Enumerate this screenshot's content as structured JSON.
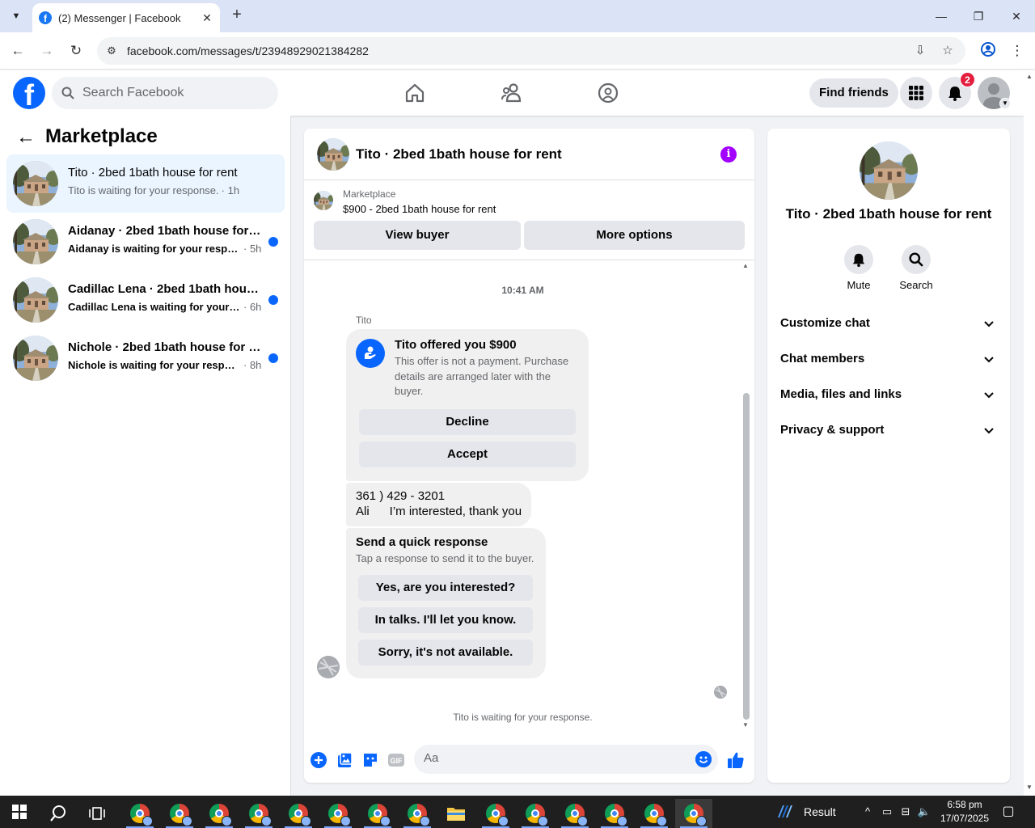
{
  "browser": {
    "tab_title": "(2) Messenger | Facebook",
    "url": "facebook.com/messages/t/23948929021384282"
  },
  "fb_header": {
    "search_placeholder": "Search Facebook",
    "find_friends": "Find friends",
    "notification_count": "2"
  },
  "sidebar": {
    "title": "Marketplace",
    "conversations": [
      {
        "name": "Tito · 2bed 1bath house for rent",
        "preview": "Tito is waiting for your response.",
        "time": "· 1h",
        "unread": false,
        "active": true
      },
      {
        "name": "Aidanay · 2bed 1bath house for r...",
        "preview": "Aidanay is waiting for your respon...",
        "time": "· 5h",
        "unread": true,
        "active": false
      },
      {
        "name": "Cadillac Lena · 2bed 1bath house...",
        "preview": "Cadillac Lena is waiting for your re...",
        "time": "· 6h",
        "unread": true,
        "active": false
      },
      {
        "name": "Nichole · 2bed 1bath house for r...",
        "preview": "Nichole is waiting for your respon...",
        "time": "· 8h",
        "unread": true,
        "active": false
      }
    ]
  },
  "chat": {
    "title": "Tito · 2bed 1bath house for rent",
    "listing_label": "Marketplace",
    "listing_price": "$900 - 2bed 1bath house for rent",
    "view_buyer": "View buyer",
    "more_options": "More options",
    "timestamp": "10:41 AM",
    "sender": "Tito",
    "offer": {
      "title": "Tito offered you $900",
      "description": "This offer is not a payment. Purchase details are arranged later with the buyer.",
      "decline": "Decline",
      "accept": "Accept"
    },
    "message": {
      "line1": "361 ) 429 - 3201",
      "line2": "Ali      I’m interested, thank you"
    },
    "quick_response": {
      "title": "Send a quick response",
      "subtitle": "Tap a response to send it to the buyer.",
      "options": [
        "Yes, are you interested?",
        "In talks. I'll let you know.",
        "Sorry, it's not available."
      ]
    },
    "waiting": "Tito is waiting for your response.",
    "composer_placeholder": "Aa",
    "gif_label": "GIF"
  },
  "right_panel": {
    "title": "Tito · 2bed 1bath house for rent",
    "actions": {
      "mute": "Mute",
      "search": "Search"
    },
    "sections": [
      "Customize chat",
      "Chat members",
      "Media, files and links",
      "Privacy & support"
    ]
  },
  "taskbar": {
    "weather_label": "Result",
    "time": "6:58 pm",
    "date": "17/07/2025"
  },
  "colors": {
    "fb_blue": "#0866ff",
    "active_row": "#ebf5ff",
    "unread_dot": "#0866ff",
    "info_purple": "#a200ff"
  }
}
